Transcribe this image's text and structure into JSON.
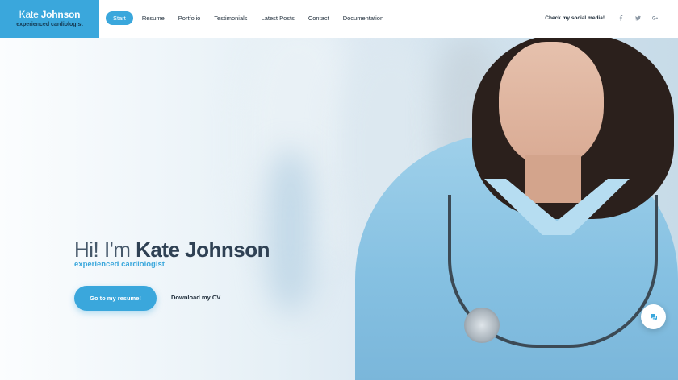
{
  "brand": {
    "first_name": "Kate",
    "last_name": "Johnson",
    "subtitle": "experienced cardiologist"
  },
  "nav": {
    "items": [
      {
        "label": "Start",
        "active": true
      },
      {
        "label": "Resume",
        "active": false
      },
      {
        "label": "Portfolio",
        "active": false
      },
      {
        "label": "Testimonials",
        "active": false
      },
      {
        "label": "Latest Posts",
        "active": false
      },
      {
        "label": "Contact",
        "active": false
      },
      {
        "label": "Documentation",
        "active": false
      }
    ]
  },
  "social": {
    "label": "Check my social media!",
    "icons": [
      "facebook-icon",
      "twitter-icon",
      "google-plus-icon"
    ]
  },
  "hero": {
    "greeting": "Hi! I'm",
    "name": "Kate Johnson",
    "subtitle": "experienced cardiologist",
    "primary_button": "Go to my resume!",
    "secondary_button": "Download my CV"
  },
  "chat": {
    "icon": "chat-icon"
  },
  "colors": {
    "accent": "#3aa7dc",
    "dark_text": "#1f2d3a",
    "brand_sub": "#14374f"
  }
}
